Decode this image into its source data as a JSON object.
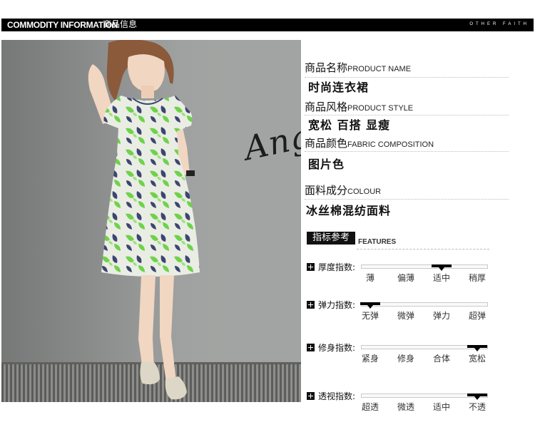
{
  "header": {
    "title_en": "COMMODITY INFORMATION",
    "title_cn": "商品信息",
    "brand": "OTHER FAITH"
  },
  "photo": {
    "watermark": "Ang"
  },
  "info": {
    "name_label_cn": "商品名称",
    "name_label_en": "PRODUCT NAME",
    "name_value": "时尚连衣裙",
    "style_label_cn": "商品风格",
    "style_label_en": "PRODUCT STYLE",
    "style_value": "宽松 百搭 显瘦",
    "color_label_cn": "商品颜色",
    "color_label_en": "FABRIC COMPOSITION",
    "color_value": "图片色",
    "fabric_label_cn": "面料成分",
    "fabric_label_en": "COLOUR",
    "fabric_value": "冰丝棉混纺面料"
  },
  "features": {
    "badge": "指标参考",
    "title_en": "FEATURES",
    "rows": [
      {
        "label": "厚度指数:",
        "options": [
          "薄",
          "偏薄",
          "适中",
          "稍厚"
        ],
        "selected": "适中"
      },
      {
        "label": "弹力指数:",
        "options": [
          "无弹",
          "微弹",
          "弹力",
          "超弹"
        ],
        "selected": "无弹"
      },
      {
        "label": "修身指数:",
        "options": [
          "紧身",
          "修身",
          "合体",
          "宽松"
        ],
        "selected": "宽松"
      },
      {
        "label": "透视指数:",
        "options": [
          "超透",
          "微透",
          "适中",
          "不透"
        ],
        "selected": "不透"
      }
    ]
  },
  "colors": {
    "dress_green": "#6fd24a",
    "dress_navy": "#3d4670",
    "dress_base": "#e9ede4"
  }
}
